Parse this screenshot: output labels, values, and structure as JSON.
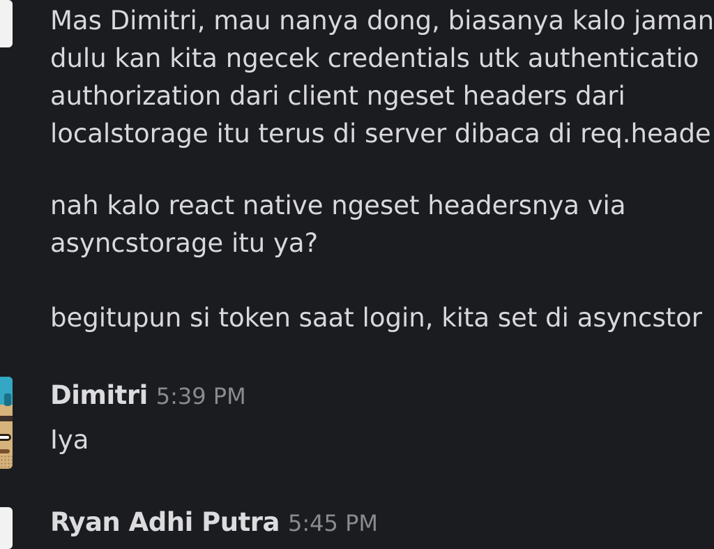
{
  "messages": {
    "first": {
      "paragraph1": "Mas Dimitri, mau nanya dong, biasanya kalo jaman\ndulu kan kita ngecek credentials utk authenticatio\nauthorization dari client ngeset headers dari\nlocalstorage itu terus di server dibaca di req.heade",
      "paragraph2": "nah kalo react native ngeset headersnya via\nasyncstorage itu ya?",
      "paragraph3": "begitupun si token saat login, kita set di asyncstor"
    },
    "dimitri": {
      "name": "Dimitri",
      "time": "5:39 PM",
      "text": "Iya"
    },
    "ryan": {
      "name": "Ryan Adhi Putra",
      "time": "5:45 PM"
    }
  },
  "colors": {
    "background": "#1b1c20",
    "text": "#d9d9dc",
    "timestamp": "#8a8a8f"
  },
  "icons": {
    "top_avatar": "avatar-icon",
    "dimitri_avatar": "avatar-icon",
    "ryan_avatar": "avatar-icon"
  }
}
